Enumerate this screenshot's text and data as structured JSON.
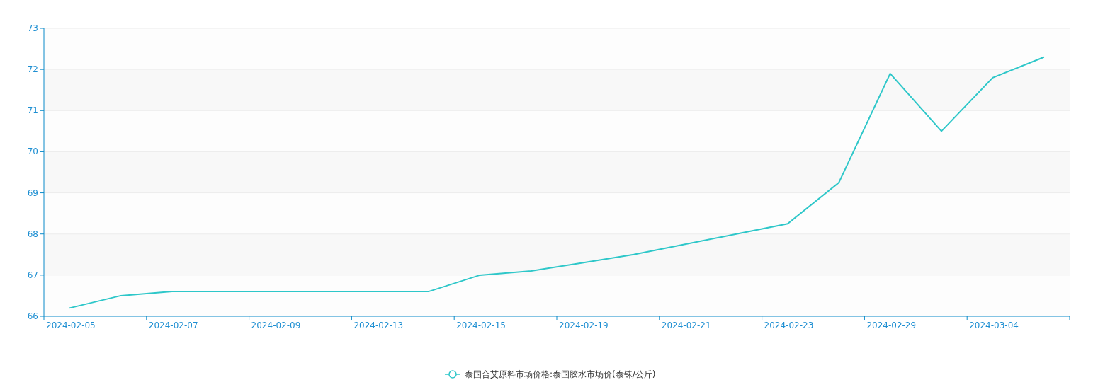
{
  "chart": {
    "chart_data": {
      "type": "line",
      "categories": [
        "2024-02-05",
        null,
        "2024-02-07",
        null,
        "2024-02-09",
        null,
        "2024-02-13",
        null,
        "2024-02-15",
        null,
        "2024-02-19",
        null,
        "2024-02-21",
        null,
        "2024-02-23",
        null,
        "2024-02-29",
        null,
        "2024-03-04",
        null
      ],
      "ylim": [
        66,
        73
      ],
      "grid": true,
      "yticks": [
        66,
        67,
        68,
        69,
        70,
        71,
        72,
        73
      ],
      "series": [
        {
          "name": "泰国合艾原料市场价格:泰国胶水市场价(泰铢/公斤)",
          "color": "#2ec7c9",
          "values": [
            66.2,
            66.5,
            66.6,
            66.6,
            66.6,
            66.6,
            66.6,
            66.6,
            67.0,
            67.1,
            67.3,
            67.5,
            67.75,
            68.0,
            68.25,
            69.25,
            71.9,
            70.5,
            71.8,
            72.3
          ]
        }
      ]
    }
  }
}
